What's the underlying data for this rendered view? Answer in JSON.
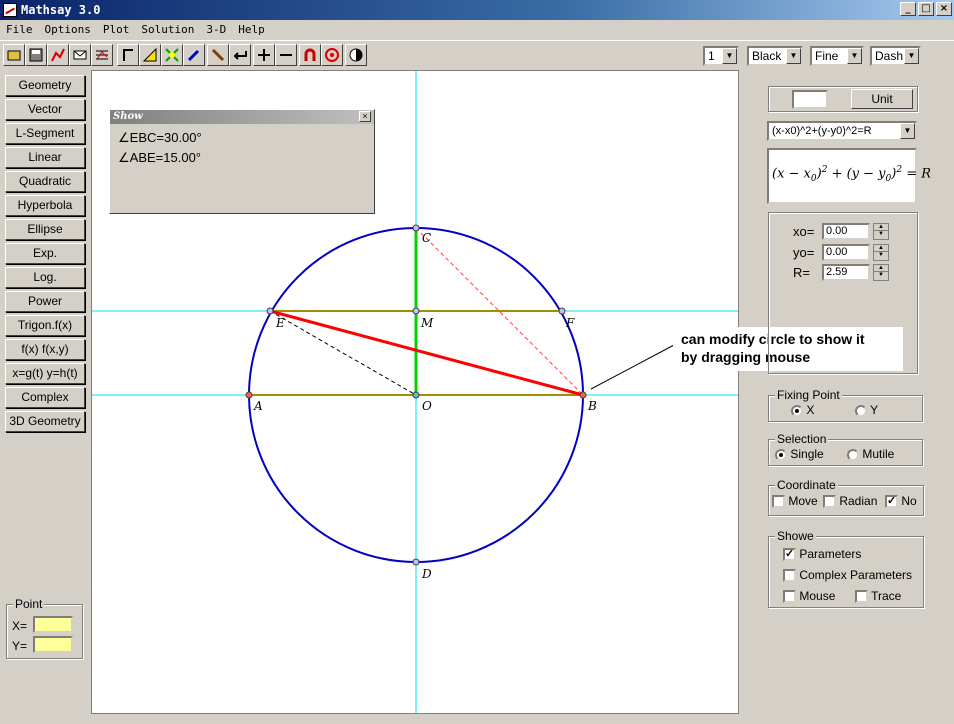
{
  "window": {
    "title": "Mathsay 3.0",
    "controls": [
      "_",
      "□",
      "×"
    ]
  },
  "menu": [
    "File",
    "Options",
    "Plot",
    "Solution",
    "3-D",
    "Help"
  ],
  "toolbar": {
    "icons": [
      "open-icon",
      "save-icon",
      "graph-icon",
      "envelope-icon",
      "grid-icon",
      "angle-icon",
      "triangle-icon",
      "cross-tool-icon",
      "pen-icon",
      "pencil-icon",
      "return-arrow-icon",
      "plus-icon",
      "minus-icon",
      "magnet-icon",
      "target-icon",
      "half-circle-icon"
    ],
    "width_value": "1",
    "color_value": "Black",
    "thickness_value": "Fine",
    "style_value": "Dash"
  },
  "left_buttons": [
    "Geometry",
    "Vector",
    "L-Segment",
    "Linear",
    "Quadratic",
    "Hyperbola",
    "Ellipse",
    "Exp.",
    "Log.",
    "Power",
    "Trigon.f(x)",
    "f(x)  f(x,y)",
    "x=g(t) y=h(t)",
    "Complex",
    "3D Geometry"
  ],
  "point_panel": {
    "legend": "Point",
    "x_label": "X=",
    "y_label": "Y=",
    "x_value": "",
    "y_value": ""
  },
  "show_panel": {
    "title": "Show",
    "close": "×",
    "angles": [
      {
        "symbol": "∠",
        "text": "EBC=30.00°"
      },
      {
        "symbol": "∠",
        "text": "ABE=15.00°"
      }
    ]
  },
  "canvas": {
    "point_labels": {
      "C": "C",
      "M": "M",
      "E": "E",
      "F": "F",
      "A": "A",
      "O": "O",
      "B": "B",
      "D": "D"
    },
    "colors": {
      "circle": "#0000c0",
      "axis": "#00e0ff",
      "chord": "#a09000",
      "segment_eb": "#ff0000",
      "segment_oc": "#00d000"
    }
  },
  "annotation": {
    "line1": "can modify circle to show it",
    "line2": "by dragging mouse"
  },
  "right": {
    "unit_value": "",
    "unit_button": "Unit",
    "equation_select": "(x-x0)^2+(y-y0)^2=R",
    "formula": {
      "a": "(x − x",
      "sub0": "0",
      "b": ")",
      "sq": "2",
      "c": " + (y − y",
      "d": ")",
      "e": " = R"
    },
    "params": [
      {
        "label": "xo=",
        "value": "0.00"
      },
      {
        "label": "yo=",
        "value": "0.00"
      },
      {
        "label": "R=",
        "value": "2.59"
      }
    ],
    "fixing_point": {
      "legend": "Fixing Point",
      "options": [
        {
          "label": "X",
          "checked": true
        },
        {
          "label": "Y",
          "checked": false
        }
      ]
    },
    "selection": {
      "legend": "Selection",
      "options": [
        {
          "label": "Single",
          "checked": true
        },
        {
          "label": "Mutile",
          "checked": false
        }
      ]
    },
    "coordinate": {
      "legend": "Coordinate",
      "options": [
        {
          "label": "Move",
          "checked": false
        },
        {
          "label": "Radian",
          "checked": false
        },
        {
          "label": "No",
          "checked": true
        }
      ]
    },
    "showe": {
      "legend": "Showe",
      "options": [
        {
          "label": "Parameters",
          "checked": true
        },
        {
          "label": "Complex Parameters",
          "checked": false
        },
        {
          "label": "Mouse",
          "checked": false
        },
        {
          "label": "Trace",
          "checked": false
        }
      ]
    }
  }
}
